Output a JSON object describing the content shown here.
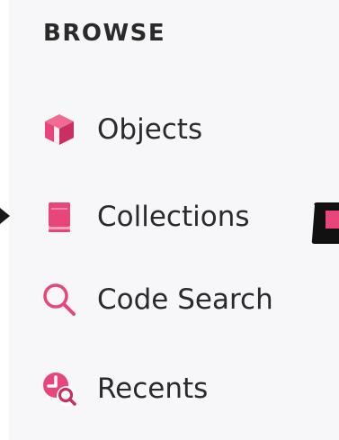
{
  "sidebar": {
    "heading": "BROWSE",
    "items": [
      {
        "label": "Objects",
        "icon": "cube-icon"
      },
      {
        "label": "Collections",
        "icon": "book-icon"
      },
      {
        "label": "Code Search",
        "icon": "search-icon"
      },
      {
        "label": "Recents",
        "icon": "recents-icon"
      }
    ]
  },
  "colors": {
    "accent": "#e8457a",
    "accent_dark": "#c9305f",
    "text": "#2a2a2a",
    "panel_bg": "#f7f7f9"
  }
}
